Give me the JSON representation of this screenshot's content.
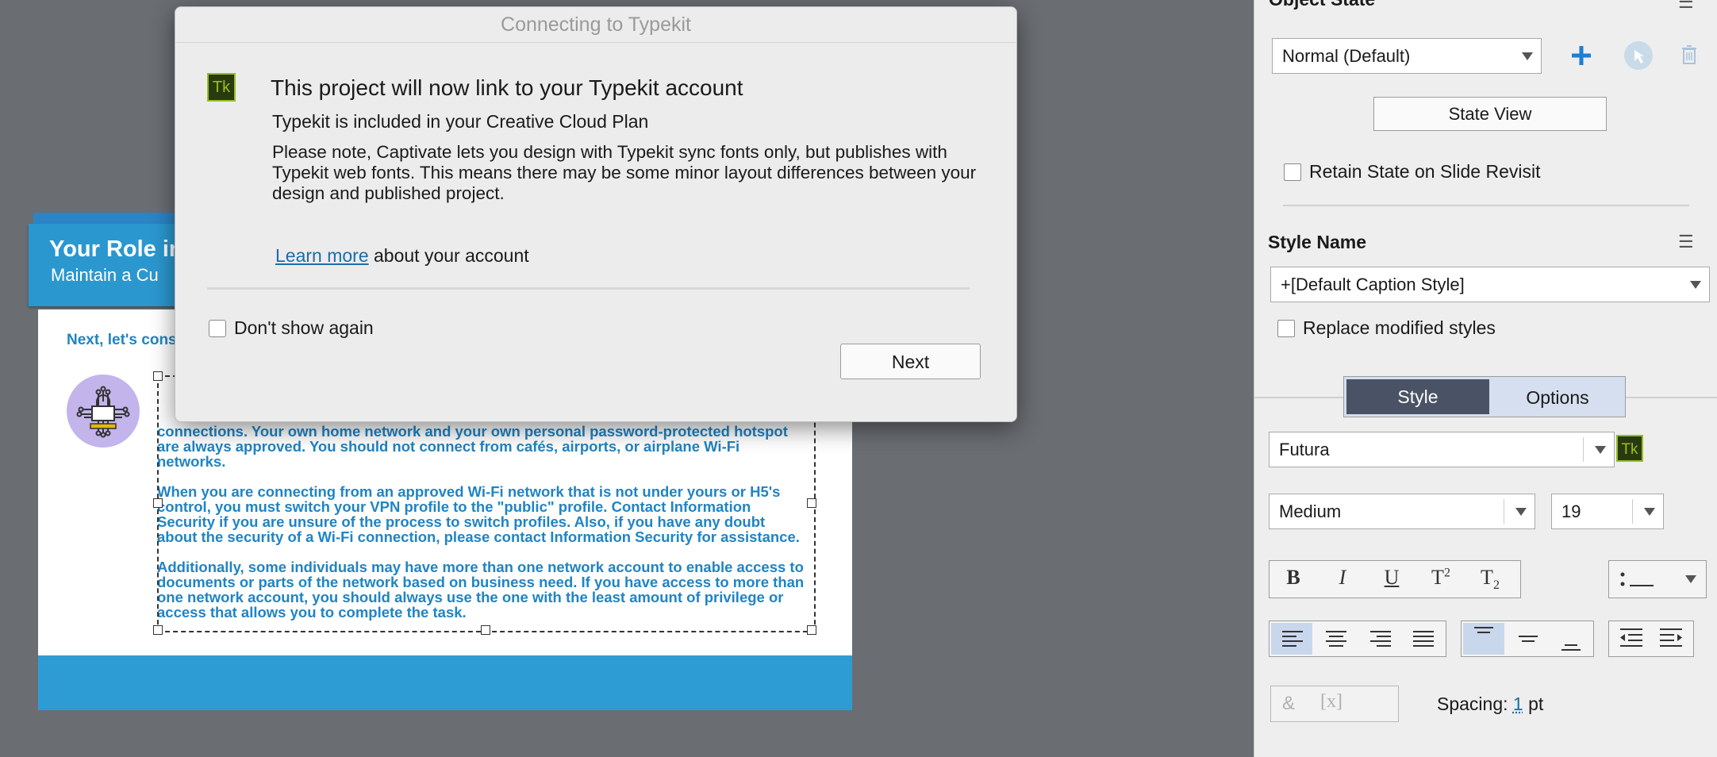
{
  "dialog": {
    "title": "Connecting to Typekit",
    "logo_text": "Tk",
    "heading": "This project will now link to your Typekit account",
    "subheading": "Typekit is included in your Creative Cloud Plan",
    "note": "Please note, Captivate lets you design with Typekit sync fonts only, but publishes with Typekit web fonts. This means there may be some minor layout differences between your design and published project.",
    "learn_more_link": "Learn more",
    "learn_more_rest": " about your account",
    "dont_show_label": "Don't show again",
    "next_button": "Next"
  },
  "slide": {
    "title": "Your Role in",
    "subtitle": "Maintain a Cu",
    "next_text": "Next, let's cons",
    "body_partial_line": "connections. Your own home network and your own personal password-protected hotspot are always approved. You should not connect from cafés, airports, or airplane Wi-Fi networks.",
    "body_paragraph_2": "When you are connecting from an approved Wi-Fi network that is not under yours or H5's control, you must switch your VPN profile to the \"public\" profile.  Contact Information Security if you are unsure of the process to switch profiles.  Also, if you have any doubt about the security of a Wi-Fi connection, please contact Information Security for assistance.",
    "body_paragraph_3": "Additionally, some individuals may have more than one network account to enable access to documents or parts of the network based on business need. If you have access to more than one network account, you should always use the one with the least amount of privilege or access that allows you to complete the task."
  },
  "panel": {
    "object_state_label": "Object State",
    "state_dropdown": "Normal (Default)",
    "state_view_button": "State View",
    "retain_state_label": "Retain State on Slide Revisit",
    "style_name_label": "Style Name",
    "style_dropdown": "+[Default Caption Style]",
    "replace_modified_label": "Replace modified styles",
    "tab_style": "Style",
    "tab_options": "Options",
    "font_family": "Futura",
    "font_logo": "Tk",
    "font_weight": "Medium",
    "font_size": "19",
    "format_buttons": [
      "B",
      "I",
      "U",
      "T",
      "T"
    ],
    "superscript_mark": "2",
    "subscript_mark": "2",
    "spacing_label": "Spacing:",
    "spacing_value": "1",
    "spacing_unit": "pt"
  },
  "colors": {
    "accent_blue": "#2b97cf",
    "slide_text": "#1f84c4",
    "active_tab": "#4a5266",
    "typekit_green": "#94c11f"
  }
}
